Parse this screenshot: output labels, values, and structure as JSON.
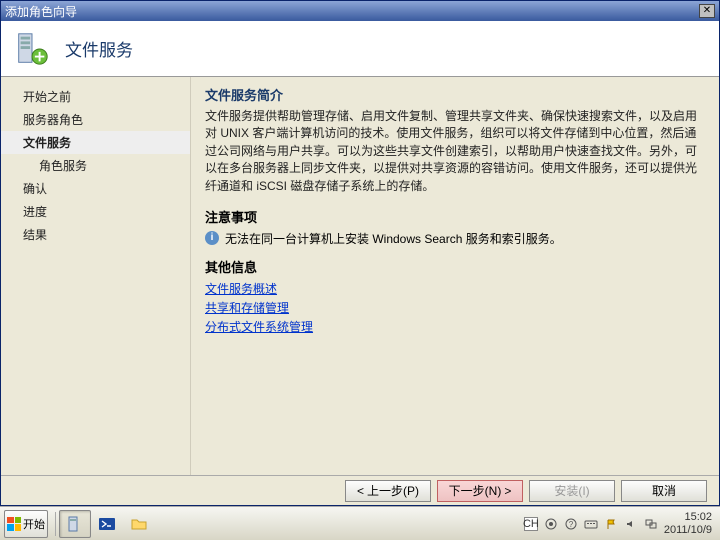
{
  "window": {
    "title": "添加角色向导"
  },
  "banner": {
    "heading": "文件服务"
  },
  "sidebar": {
    "items": [
      {
        "label": "开始之前",
        "active": false,
        "sub": false
      },
      {
        "label": "服务器角色",
        "active": false,
        "sub": false
      },
      {
        "label": "文件服务",
        "active": true,
        "sub": false
      },
      {
        "label": "角色服务",
        "active": false,
        "sub": true
      },
      {
        "label": "确认",
        "active": false,
        "sub": false
      },
      {
        "label": "进度",
        "active": false,
        "sub": false
      },
      {
        "label": "结果",
        "active": false,
        "sub": false
      }
    ]
  },
  "content": {
    "intro_heading": "文件服务简介",
    "intro_text": "文件服务提供帮助管理存储、启用文件复制、管理共享文件夹、确保快速搜索文件，以及启用对 UNIX 客户端计算机访问的技术。使用文件服务，组织可以将文件存储到中心位置，然后通过公司网络与用户共享。可以为这些共享文件创建索引，以帮助用户快速查找文件。另外，可以在多台服务器上同步文件夹，以提供对共享资源的容错访问。使用文件服务，还可以提供光纤通道和 iSCSI 磁盘存储子系统上的存储。",
    "notes_heading": "注意事项",
    "note_text": "无法在同一台计算机上安装 Windows Search 服务和索引服务。",
    "other_heading": "其他信息",
    "links": [
      "文件服务概述",
      "共享和存储管理",
      "分布式文件系统管理"
    ]
  },
  "buttons": {
    "prev": "上一步(P)",
    "next": "下一步(N)",
    "install": "安装(I)",
    "cancel": "取消"
  },
  "taskbar": {
    "start": "开始",
    "ime": "CH",
    "time": "15:02",
    "date": "2011/10/9"
  }
}
